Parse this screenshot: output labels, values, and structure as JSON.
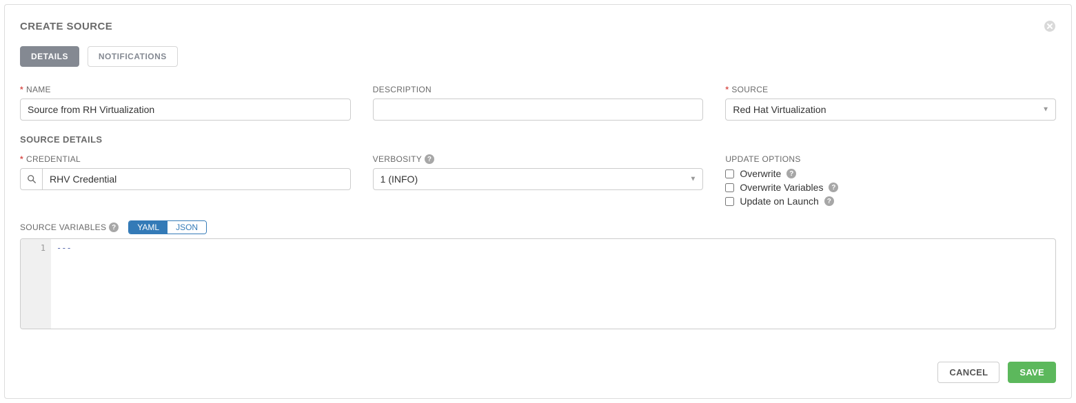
{
  "header": {
    "title": "CREATE SOURCE"
  },
  "tabs": {
    "details": "DETAILS",
    "notifications": "NOTIFICATIONS"
  },
  "fields": {
    "name": {
      "label": "NAME",
      "value": "Source from RH Virtualization"
    },
    "description": {
      "label": "DESCRIPTION",
      "value": ""
    },
    "source": {
      "label": "SOURCE",
      "value": "Red Hat Virtualization"
    }
  },
  "source_details": {
    "title": "SOURCE DETAILS",
    "credential": {
      "label": "CREDENTIAL",
      "value": "RHV Credential"
    },
    "verbosity": {
      "label": "VERBOSITY",
      "value": "1 (INFO)"
    },
    "update_options": {
      "label": "UPDATE OPTIONS",
      "overwrite": "Overwrite",
      "overwrite_vars": "Overwrite Variables",
      "update_on_launch": "Update on Launch"
    }
  },
  "source_variables": {
    "label": "SOURCE VARIABLES",
    "toggle_yaml": "YAML",
    "toggle_json": "JSON",
    "line1": "1",
    "content": "---"
  },
  "buttons": {
    "cancel": "CANCEL",
    "save": "SAVE"
  }
}
